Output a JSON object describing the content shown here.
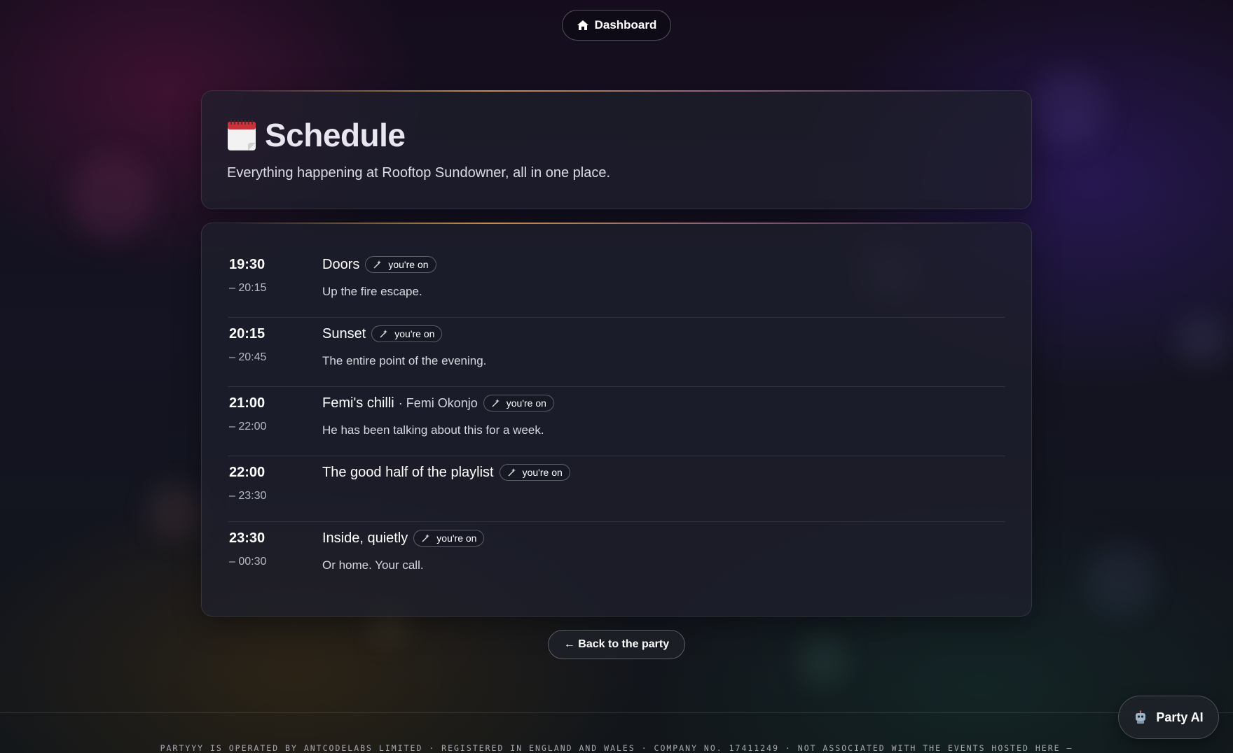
{
  "nav": {
    "dashboard_label": "Dashboard",
    "dashboard_icon": "home-icon"
  },
  "header": {
    "icon": "calendar-icon",
    "title": "Schedule",
    "subtitle": "Everything happening at Rooftop Sundowner, all in one place."
  },
  "schedule": {
    "badge_icon": "wand-icon",
    "items": [
      {
        "start": "19:30",
        "end": "– 20:15",
        "title": "Doors",
        "host": "",
        "badge": "you're on",
        "description": "Up the fire escape."
      },
      {
        "start": "20:15",
        "end": "– 20:45",
        "title": "Sunset",
        "host": "",
        "badge": "you're on",
        "description": "The entire point of the evening."
      },
      {
        "start": "21:00",
        "end": "– 22:00",
        "title": "Femi's chilli",
        "host": "· Femi Okonjo",
        "badge": "you're on",
        "description": "He has been talking about this for a week."
      },
      {
        "start": "22:00",
        "end": "– 23:30",
        "title": "The good half of the playlist",
        "host": "",
        "badge": "you're on",
        "description": ""
      },
      {
        "start": "23:30",
        "end": "– 00:30",
        "title": "Inside, quietly",
        "host": "",
        "badge": "you're on",
        "description": "Or home. Your call."
      }
    ]
  },
  "back_label": "← Back to the party",
  "footer": {
    "text": "PARTYYY IS OPERATED BY ANTCODELABS LIMITED · REGISTERED IN ENGLAND AND WALES · COMPANY NO. 17411249 · NOT ASSOCIATED WITH THE EVENTS HOSTED HERE —"
  },
  "assistant": {
    "label": "Party AI",
    "icon": "robot-icon"
  },
  "colors": {
    "accent_gradient_start": "#e6aa5a",
    "accent_gradient_end": "#c882aa",
    "background": "#141422"
  }
}
